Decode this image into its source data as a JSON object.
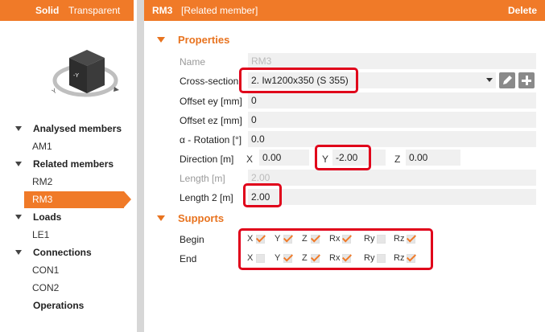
{
  "left_panel": {
    "view_toggle": {
      "solid": "Solid",
      "transparent": "Transparent"
    },
    "cube": {
      "face_label": "-Y",
      "axis_label": "Y"
    },
    "tree": [
      {
        "label": "Analysed members",
        "type": "group",
        "expanded": true
      },
      {
        "label": "AM1",
        "type": "child"
      },
      {
        "label": "Related members",
        "type": "group",
        "expanded": true
      },
      {
        "label": "RM2",
        "type": "child"
      },
      {
        "label": "RM3",
        "type": "child",
        "selected": true
      },
      {
        "label": "Loads",
        "type": "group",
        "expanded": true
      },
      {
        "label": "LE1",
        "type": "child"
      },
      {
        "label": "Connections",
        "type": "group",
        "expanded": true
      },
      {
        "label": "CON1",
        "type": "child"
      },
      {
        "label": "CON2",
        "type": "child"
      },
      {
        "label": "Operations",
        "type": "group",
        "expanded": false
      }
    ]
  },
  "header": {
    "title": "RM3",
    "subtitle": "[Related member]",
    "delete_label": "Delete"
  },
  "properties": {
    "section_title": "Properties",
    "name": {
      "label": "Name",
      "value": "RM3"
    },
    "cross_section": {
      "label": "Cross-section",
      "value": "2. Iw1200x350 (S 355)"
    },
    "offset_ey": {
      "label": "Offset ey [mm]",
      "value": "0"
    },
    "offset_ez": {
      "label": "Offset ez [mm]",
      "value": "0"
    },
    "rotation": {
      "label": "α - Rotation [°]",
      "value": "0.0"
    },
    "direction": {
      "label": "Direction [m]",
      "x_label": "X",
      "x": "0.00",
      "y_label": "Y",
      "y": "-2.00",
      "z_label": "Z",
      "z": "0.00"
    },
    "length": {
      "label": "Length [m]",
      "value": "2.00"
    },
    "length2": {
      "label": "Length 2 [m]",
      "value": "2.00"
    }
  },
  "supports": {
    "section_title": "Supports",
    "columns": [
      "X",
      "Y",
      "Z",
      "Rx",
      "Ry",
      "Rz"
    ],
    "begin": {
      "label": "Begin",
      "checked": [
        true,
        true,
        true,
        true,
        false,
        true
      ]
    },
    "end": {
      "label": "End",
      "checked": [
        false,
        true,
        true,
        true,
        false,
        true
      ]
    }
  },
  "colors": {
    "accent": "#f07a28",
    "highlight": "#e0001a"
  }
}
